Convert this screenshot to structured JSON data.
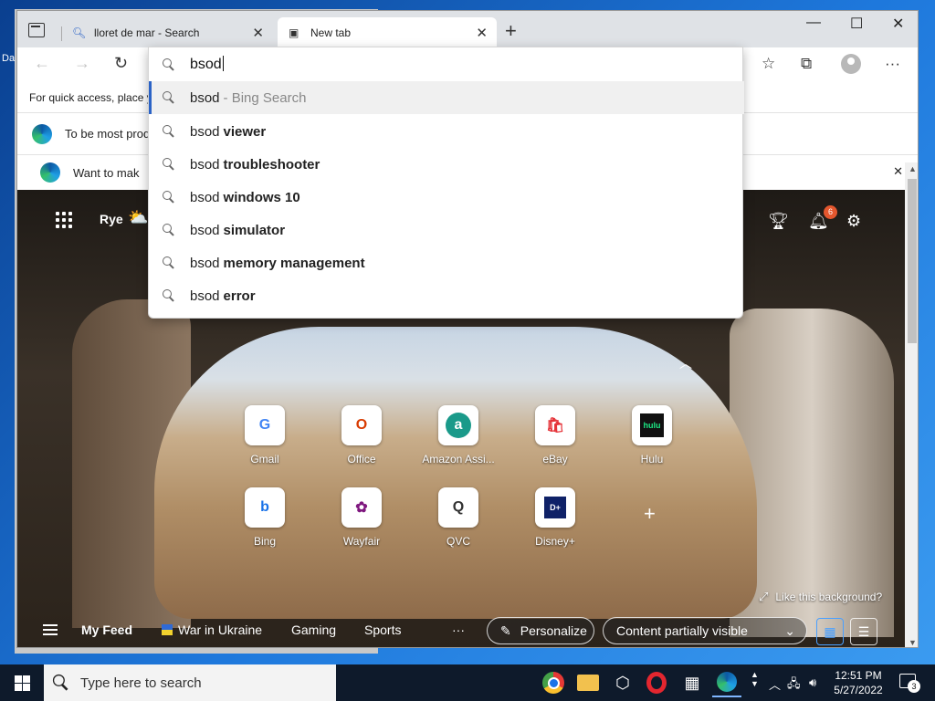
{
  "desktop": {
    "partial_label": "Da"
  },
  "browser": {
    "tabs": [
      {
        "title": "lloret de mar - Search",
        "icon": "search-icon"
      },
      {
        "title": "New tab",
        "icon": "newtab-icon"
      }
    ],
    "favorites_bar": {
      "text": "For quick access, place y"
    },
    "infobar": {
      "text": "To be most prod"
    },
    "infobar2": {
      "text": "Want to mak"
    },
    "address_bar": {
      "value": "bsod"
    },
    "suggestions": [
      {
        "prefix": "bsod",
        "hint": "- Bing Search",
        "highlighted": true
      },
      {
        "prefix": "bsod",
        "bold": "viewer"
      },
      {
        "prefix": "bsod",
        "bold": "troubleshooter"
      },
      {
        "prefix": "bsod",
        "bold": "windows 10"
      },
      {
        "prefix": "bsod",
        "bold": "simulator"
      },
      {
        "prefix": "bsod",
        "bold": "memory management"
      },
      {
        "prefix": "bsod",
        "bold": "error"
      }
    ]
  },
  "newtab": {
    "location": "Rye",
    "weather_icon": "partly-cloudy-icon",
    "notification_count": "6",
    "quick_links": [
      {
        "label": "Gmail",
        "glyph": "G",
        "color": "#4285f4"
      },
      {
        "label": "Office",
        "glyph": "O",
        "color": "#d83b01"
      },
      {
        "label": "Amazon Assi...",
        "glyph": "a",
        "color": "#ffffff",
        "bg": "#1a9a8a"
      },
      {
        "label": "eBay",
        "glyph": "🛍",
        "color": "#e53238"
      },
      {
        "label": "Hulu",
        "glyph": "hulu",
        "color": "#1ce783",
        "bg": "#111111"
      },
      {
        "label": "Bing",
        "glyph": "b",
        "color": "#1a73e8"
      },
      {
        "label": "Wayfair",
        "glyph": "✿",
        "color": "#7f187f"
      },
      {
        "label": "QVC",
        "glyph": "Q",
        "color": "#333333"
      },
      {
        "label": "Disney+",
        "glyph": "D+",
        "color": "#ffffff",
        "bg": "#0f2167"
      }
    ],
    "like_background": "Like this background?",
    "feed": {
      "my_feed": "My Feed",
      "war_in_ukraine": "War in Ukraine",
      "gaming": "Gaming",
      "sports": "Sports",
      "more": "···",
      "personalize": "Personalize",
      "content_visibility": "Content partially visible"
    }
  },
  "taskbar": {
    "search_placeholder": "Type here to search",
    "time": "12:51 PM",
    "date": "5/27/2022",
    "notification_count": "3"
  }
}
